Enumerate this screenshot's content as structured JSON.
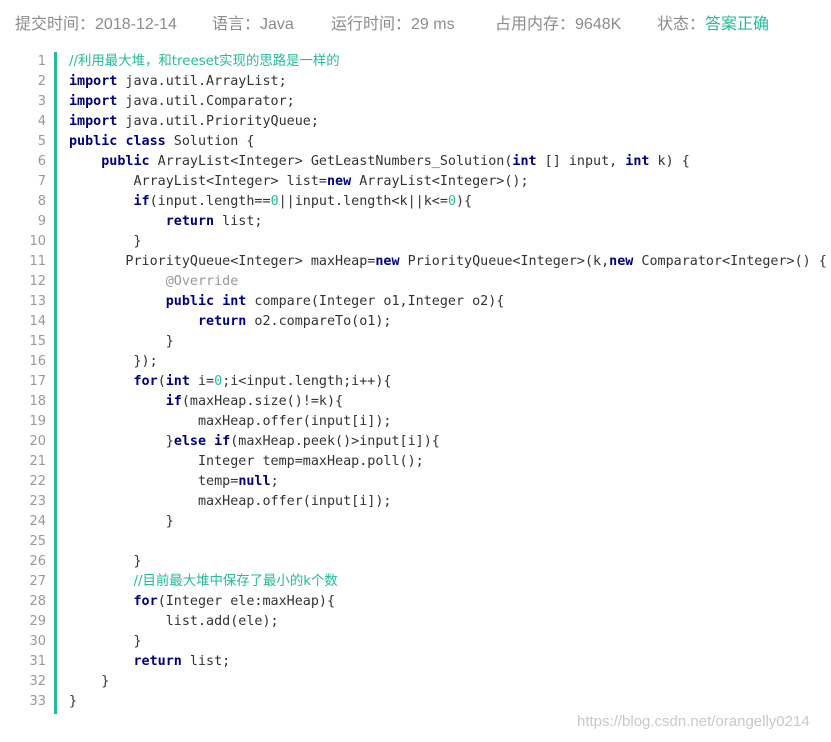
{
  "submission": {
    "submit_time_label": "提交时间：",
    "submit_time_value": "2018-12-14",
    "language_label": "语言：",
    "language_value": "Java",
    "runtime_label": "运行时间：",
    "runtime_value": "29 ms",
    "memory_label": "占用内存：",
    "memory_value": "9648K",
    "status_label": "状态：",
    "status_value": "答案正确"
  },
  "colors": {
    "accent": "#25bb9b",
    "keyword": "#000080",
    "annotation": "#999999",
    "meta_text": "#8c8c8c"
  },
  "code": {
    "lines": [
      [
        [
          "cm",
          "//利用最大堆，和treeset实现的思路是一样的"
        ]
      ],
      [
        [
          "kw",
          "import"
        ],
        [
          "pl",
          " java.util.ArrayList;"
        ]
      ],
      [
        [
          "kw",
          "import"
        ],
        [
          "pl",
          " java.util.Comparator;"
        ]
      ],
      [
        [
          "kw",
          "import"
        ],
        [
          "pl",
          " java.util.PriorityQueue;"
        ]
      ],
      [
        [
          "kw",
          "public"
        ],
        [
          "pl",
          " "
        ],
        [
          "kw",
          "class"
        ],
        [
          "pl",
          " Solution {"
        ]
      ],
      [
        [
          "pl",
          "    "
        ],
        [
          "kw",
          "public"
        ],
        [
          "pl",
          " ArrayList<Integer> GetLeastNumbers_Solution("
        ],
        [
          "kw",
          "int"
        ],
        [
          "pl",
          " [] input, "
        ],
        [
          "kw",
          "int"
        ],
        [
          "pl",
          " k) {"
        ]
      ],
      [
        [
          "pl",
          "        ArrayList<Integer> list="
        ],
        [
          "kw",
          "new"
        ],
        [
          "pl",
          " ArrayList<Integer>();"
        ]
      ],
      [
        [
          "pl",
          "        "
        ],
        [
          "kw",
          "if"
        ],
        [
          "pl",
          "(input.length=="
        ],
        [
          "num",
          "0"
        ],
        [
          "pl",
          "||input.length<k||k<="
        ],
        [
          "num",
          "0"
        ],
        [
          "pl",
          "){"
        ]
      ],
      [
        [
          "pl",
          "            "
        ],
        [
          "kw",
          "return"
        ],
        [
          "pl",
          " list;"
        ]
      ],
      [
        [
          "pl",
          "        }"
        ]
      ],
      [
        [
          "pl",
          "       PriorityQueue<Integer> maxHeap="
        ],
        [
          "kw",
          "new"
        ],
        [
          "pl",
          " PriorityQueue<Integer>(k,"
        ],
        [
          "kw",
          "new"
        ],
        [
          "pl",
          " Comparator<Integer>() {"
        ]
      ],
      [
        [
          "pl",
          "            "
        ],
        [
          "an",
          "@Override"
        ]
      ],
      [
        [
          "pl",
          "            "
        ],
        [
          "kw",
          "public"
        ],
        [
          "pl",
          " "
        ],
        [
          "kw",
          "int"
        ],
        [
          "pl",
          " compare(Integer o1,Integer o2){"
        ]
      ],
      [
        [
          "pl",
          "                "
        ],
        [
          "kw",
          "return"
        ],
        [
          "pl",
          " o2.compareTo(o1);"
        ]
      ],
      [
        [
          "pl",
          "            }"
        ]
      ],
      [
        [
          "pl",
          "        });"
        ]
      ],
      [
        [
          "pl",
          "        "
        ],
        [
          "kw",
          "for"
        ],
        [
          "pl",
          "("
        ],
        [
          "kw",
          "int"
        ],
        [
          "pl",
          " i="
        ],
        [
          "num",
          "0"
        ],
        [
          "pl",
          ";i<input.length;i++){"
        ]
      ],
      [
        [
          "pl",
          "            "
        ],
        [
          "kw",
          "if"
        ],
        [
          "pl",
          "(maxHeap.size()!=k){"
        ]
      ],
      [
        [
          "pl",
          "                maxHeap.offer(input[i]);"
        ]
      ],
      [
        [
          "pl",
          "            }"
        ],
        [
          "kw",
          "else"
        ],
        [
          "pl",
          " "
        ],
        [
          "kw",
          "if"
        ],
        [
          "pl",
          "(maxHeap.peek()>input[i]){"
        ]
      ],
      [
        [
          "pl",
          "                Integer temp=maxHeap.poll();"
        ]
      ],
      [
        [
          "pl",
          "                temp="
        ],
        [
          "kw",
          "null"
        ],
        [
          "pl",
          ";"
        ]
      ],
      [
        [
          "pl",
          "                maxHeap.offer(input[i]);"
        ]
      ],
      [
        [
          "pl",
          "            }"
        ]
      ],
      [
        [
          "pl",
          ""
        ]
      ],
      [
        [
          "pl",
          "        }"
        ]
      ],
      [
        [
          "pl",
          "        "
        ],
        [
          "cm",
          "//目前最大堆中保存了最小的k个数"
        ]
      ],
      [
        [
          "pl",
          "        "
        ],
        [
          "kw",
          "for"
        ],
        [
          "pl",
          "(Integer ele:maxHeap){"
        ]
      ],
      [
        [
          "pl",
          "            list.add(ele);"
        ]
      ],
      [
        [
          "pl",
          "        }"
        ]
      ],
      [
        [
          "pl",
          "        "
        ],
        [
          "kw",
          "return"
        ],
        [
          "pl",
          " list;"
        ]
      ],
      [
        [
          "pl",
          "    }"
        ]
      ],
      [
        [
          "pl",
          "}"
        ]
      ]
    ]
  },
  "watermark": {
    "text": "https://blog.csdn.net/orangelly0214"
  }
}
